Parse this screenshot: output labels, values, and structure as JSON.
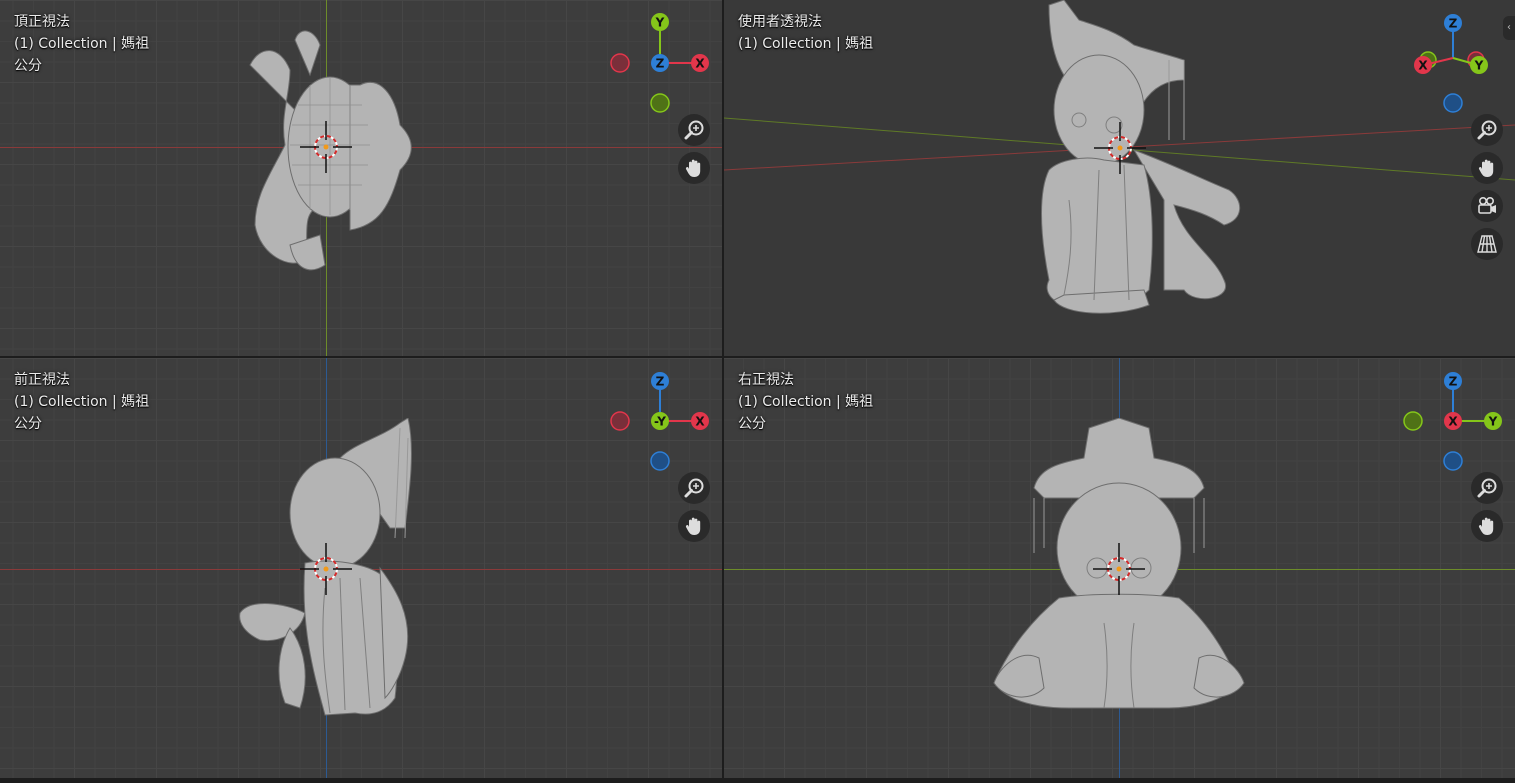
{
  "viewports": {
    "top": {
      "view_name": "頂正視法",
      "collection": "(1) Collection | 媽祖",
      "units": "公分",
      "gizmo": {
        "center": "Z",
        "up": "Y",
        "right": "X"
      }
    },
    "user": {
      "view_name": "使用者透視法",
      "collection": "(1) Collection | 媽祖",
      "gizmo": {
        "up": "Z",
        "left": "X",
        "right": "Y"
      }
    },
    "front": {
      "view_name": "前正視法",
      "collection": "(1) Collection | 媽祖",
      "units": "公分",
      "gizmo": {
        "up": "Z",
        "center": "-Y",
        "right": "X"
      }
    },
    "right": {
      "view_name": "右正視法",
      "collection": "(1) Collection | 媽祖",
      "units": "公分",
      "gizmo": {
        "up": "Z",
        "center": "X",
        "right": "Y"
      }
    }
  },
  "colors": {
    "axis_x": "#e2364b",
    "axis_y": "#85c61a",
    "axis_z": "#2e7fd6",
    "grid_bg": "#3d3d3d",
    "model": "#b4b4b4"
  },
  "icons": [
    "zoom-icon",
    "hand-pan-icon",
    "camera-icon",
    "grid-perspective-icon"
  ]
}
